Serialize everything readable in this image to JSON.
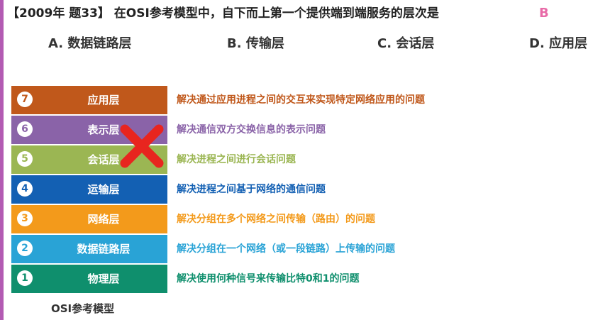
{
  "question": {
    "text": "【2009年 题33】 在OSI参考模型中，自下而上第一个提供端到端服务的层次是",
    "answer": "B"
  },
  "options": [
    {
      "label": "A. 数据链路层"
    },
    {
      "label": "B. 传输层"
    },
    {
      "label": "C. 会话层"
    },
    {
      "label": "D. 应用层"
    }
  ],
  "layers": [
    {
      "number": "7",
      "name": "应用层",
      "description": "解决通过应用进程之间的交互来实现特定网络应用的问题",
      "color": "#c0581b"
    },
    {
      "number": "6",
      "name": "表示层",
      "description": "解决通信双方交换信息的表示问题",
      "color": "#8a63a8"
    },
    {
      "number": "5",
      "name": "会话层",
      "description": "解决进程之间进行会话问题",
      "color": "#9bb653"
    },
    {
      "number": "4",
      "name": "运输层",
      "description": "解决进程之间基于网络的通信问题",
      "color": "#1360b3"
    },
    {
      "number": "3",
      "name": "网络层",
      "description": "解决分组在多个网络之间传输（路由）的问题",
      "color": "#f39a1b"
    },
    {
      "number": "2",
      "name": "数据链路层",
      "description": "解决分组在一个网络（或一段链路）上传输的问题",
      "color": "#29a3d6"
    },
    {
      "number": "1",
      "name": "物理层",
      "description": "解决使用何种信号来传输比特0和1的问题",
      "color": "#0f8f6d"
    }
  ],
  "cross_mark_color": "#e8251f",
  "caption": "OSI参考模型"
}
